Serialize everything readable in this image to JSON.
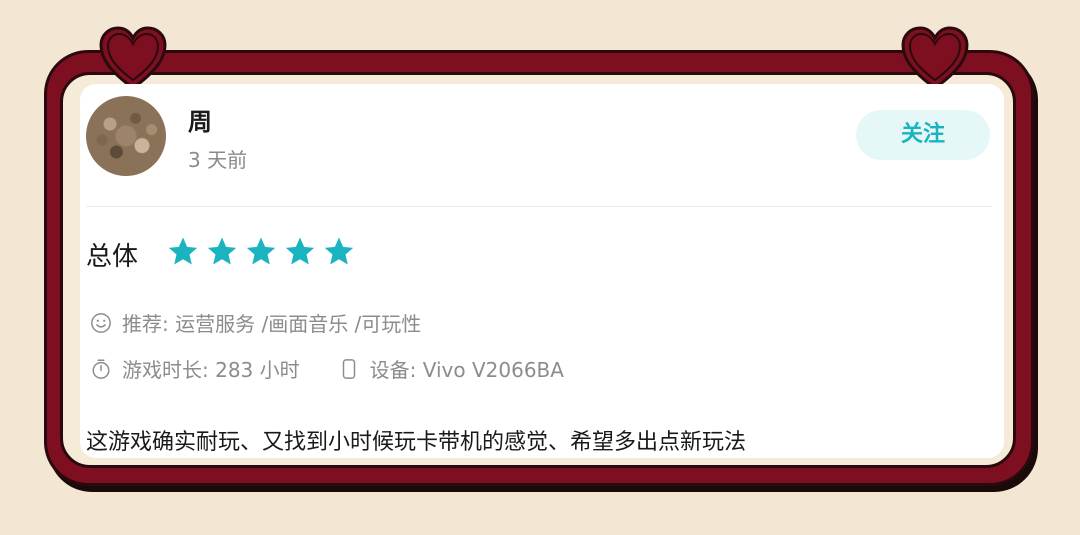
{
  "user": {
    "name": "周",
    "time": "3 天前",
    "avatar_icon": "avatar-photo"
  },
  "follow_button": {
    "label": "关注"
  },
  "rating": {
    "label": "总体",
    "stars": 5,
    "max_stars": 5,
    "star_color": "#1ab3c0"
  },
  "recommend": {
    "icon": "smile-icon",
    "text": "推荐: 运营服务 /画面音乐 /可玩性"
  },
  "stats": {
    "playtime_icon": "stopwatch-icon",
    "playtime": "游戏时长:  283 小时",
    "device_icon": "phone-icon",
    "device": "设备:  Vivo V2066BA"
  },
  "review": {
    "text": "这游戏确实耐玩、又找到小时候玩卡带机的感觉、希望多出点新玩法"
  },
  "colors": {
    "frame": "#7e0f20",
    "background": "#f3e6d3",
    "accent": "#1ab3c0"
  }
}
